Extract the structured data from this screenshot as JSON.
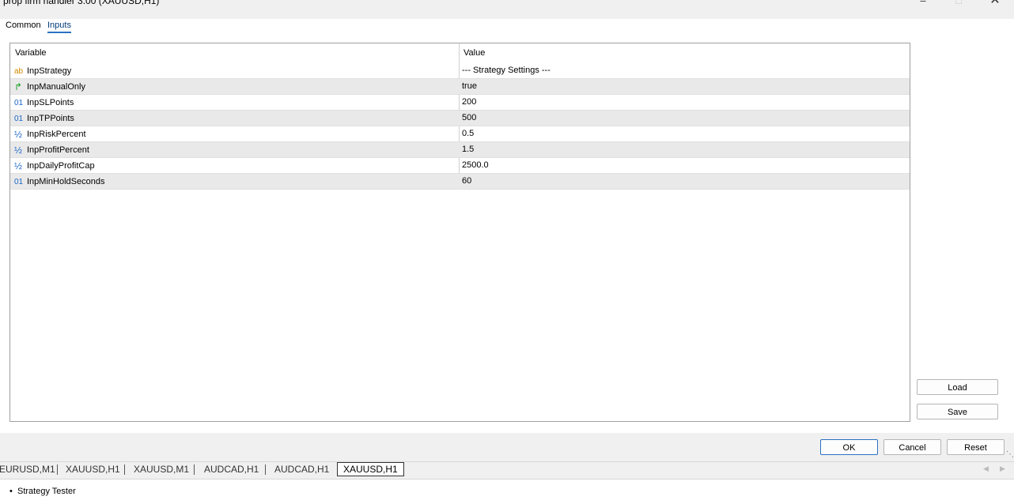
{
  "window": {
    "title": "prop firm handler 3.00 (XAUUSD,H1)",
    "minimize_icon": "minimize-icon",
    "maximize_icon": "maximize-icon",
    "close_icon": "close-icon"
  },
  "tabs": [
    {
      "label": "Common",
      "active": false
    },
    {
      "label": "Inputs",
      "active": true
    }
  ],
  "grid": {
    "headers": {
      "variable": "Variable",
      "value": "Value"
    },
    "rows": [
      {
        "type_icon": "ab",
        "type": "string-icon",
        "name": "InpStrategy",
        "value": "--- Strategy Settings ---"
      },
      {
        "type_icon": "↱",
        "type": "bool-icon",
        "name": "InpManualOnly",
        "value": "true"
      },
      {
        "type_icon": "01",
        "type": "int-icon",
        "name": "InpSLPoints",
        "value": "200"
      },
      {
        "type_icon": "01",
        "type": "int-icon",
        "name": "InpTPPoints",
        "value": "500"
      },
      {
        "type_icon": "½",
        "type": "double-icon",
        "name": "InpRiskPercent",
        "value": "0.5"
      },
      {
        "type_icon": "½",
        "type": "double-icon",
        "name": "InpProfitPercent",
        "value": "1.5"
      },
      {
        "type_icon": "½",
        "type": "double-icon",
        "name": "InpDailyProfitCap",
        "value": "2500.0"
      },
      {
        "type_icon": "01",
        "type": "int-icon",
        "name": "InpMinHoldSeconds",
        "value": "60"
      }
    ]
  },
  "side_buttons": {
    "load": "Load",
    "save": "Save"
  },
  "dialog_buttons": {
    "ok": "OK",
    "cancel": "Cancel",
    "reset": "Reset"
  },
  "chart_tabs": [
    {
      "label": "EURUSD,M1",
      "active": false
    },
    {
      "label": "XAUUSD,H1",
      "active": false
    },
    {
      "label": "XAUUSD,M1",
      "active": false
    },
    {
      "label": "AUDCAD,H1",
      "active": false
    },
    {
      "label": "AUDCAD,H1",
      "active": false
    },
    {
      "label": "XAUUSD,H1",
      "active": true
    }
  ],
  "status": {
    "bullet": "•",
    "label": "Strategy Tester"
  },
  "colors": {
    "accent": "#2a72c2",
    "string_icon": "#d08a00",
    "bool_icon": "#1aa12a",
    "int_icon": "#1a66c8"
  }
}
